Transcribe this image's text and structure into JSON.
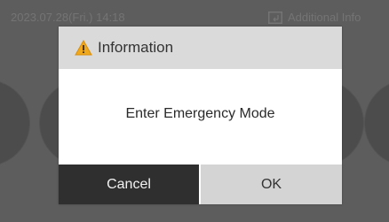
{
  "status_bar": {
    "datetime": "2023.07.28(Fri.) 14:18",
    "additional_info_label": "Additional Info",
    "back_icon": "back-arrow-icon"
  },
  "dialog": {
    "title": "Information",
    "title_icon": "warning-icon",
    "message": "Enter Emergency Mode",
    "cancel_label": "Cancel",
    "ok_label": "OK"
  },
  "colors": {
    "overlay_background": "#5d5d5d",
    "dialog_header": "#dadada",
    "cancel_button": "#2f2f2f",
    "ok_button": "#d4d4d4",
    "warning_accent": "#f0a81c"
  }
}
